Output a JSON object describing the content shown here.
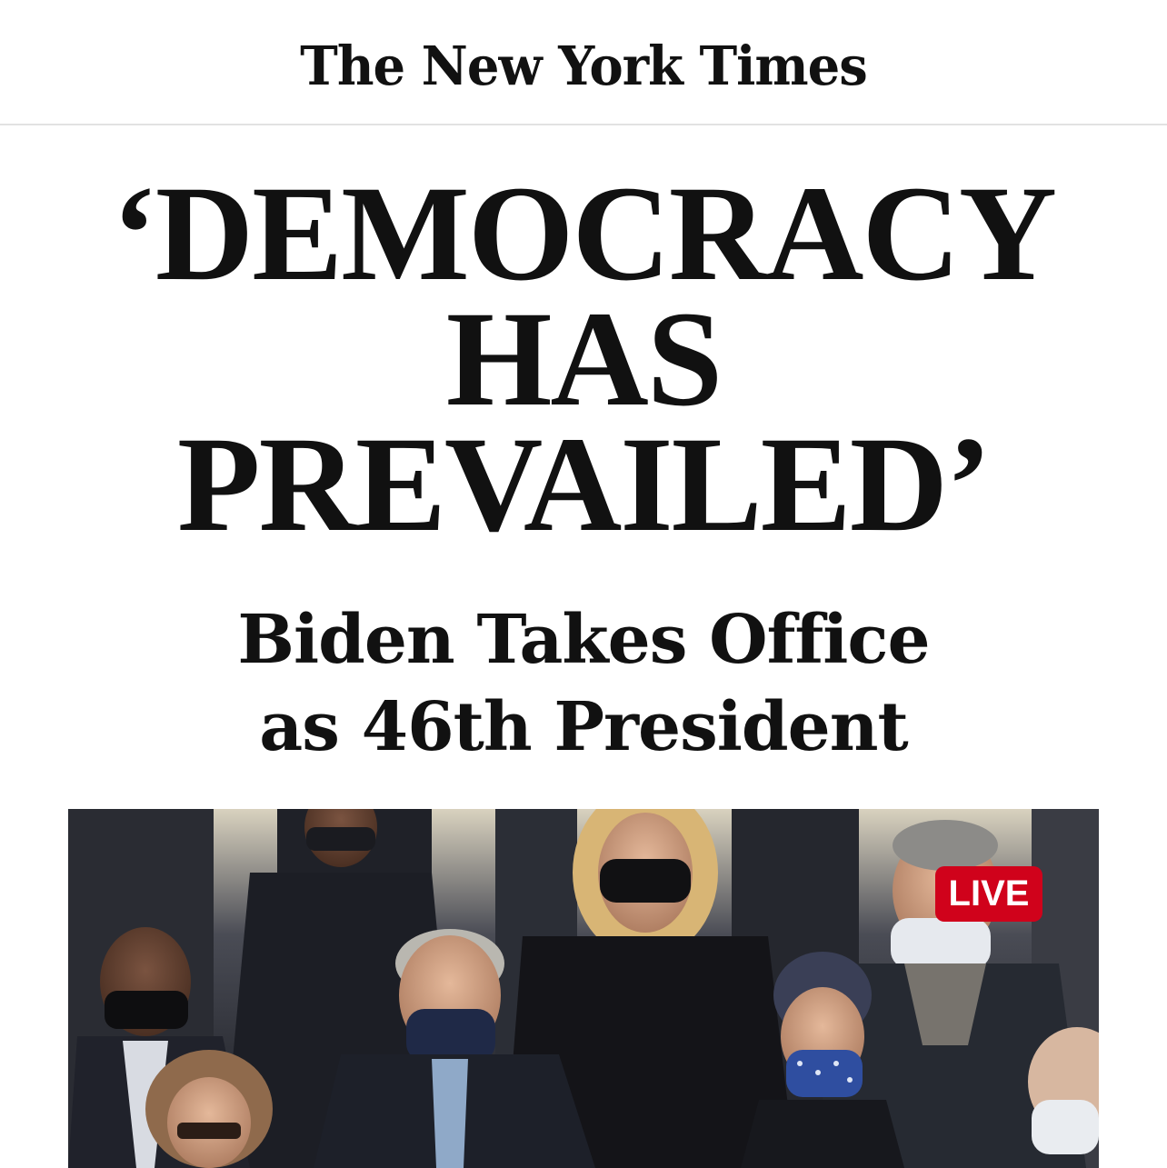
{
  "masthead": {
    "logo_text": "The New York Times"
  },
  "article": {
    "headline_lines": [
      "‘DEMOCRACY",
      "HAS",
      "PREVAILED’"
    ],
    "subhead_lines": [
      "Biden Takes Office",
      "as 46th President"
    ]
  },
  "photo": {
    "badge_label": "LIVE"
  },
  "colors": {
    "badge_red": "#d0021b",
    "text": "#111111",
    "divider": "#e2e2e2"
  }
}
